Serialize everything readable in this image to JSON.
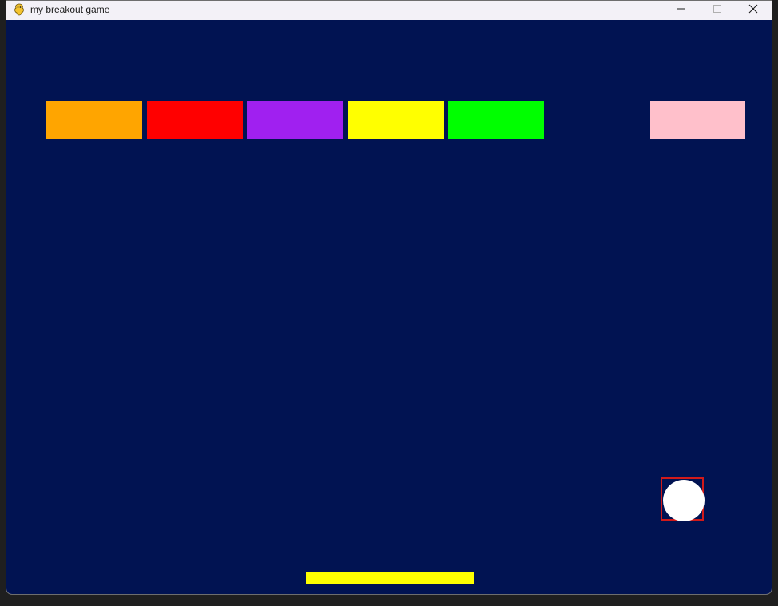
{
  "window": {
    "title": "my breakout game"
  },
  "icons": {
    "app": "pygame-snake-icon",
    "minimize": "minimize-icon",
    "maximize": "maximize-icon",
    "close": "close-icon"
  },
  "colors": {
    "background": "#011352",
    "paddle": "#ffff00",
    "ball": "#ffffff",
    "hitbox": "#d11a1a"
  },
  "bricks": [
    {
      "color": "#ffa500"
    },
    {
      "color": "#ff0000"
    },
    {
      "color": "#a020f0"
    },
    {
      "color": "#ffff00"
    },
    {
      "color": "#00ff00"
    },
    {
      "color": "#ffc0cb"
    }
  ]
}
